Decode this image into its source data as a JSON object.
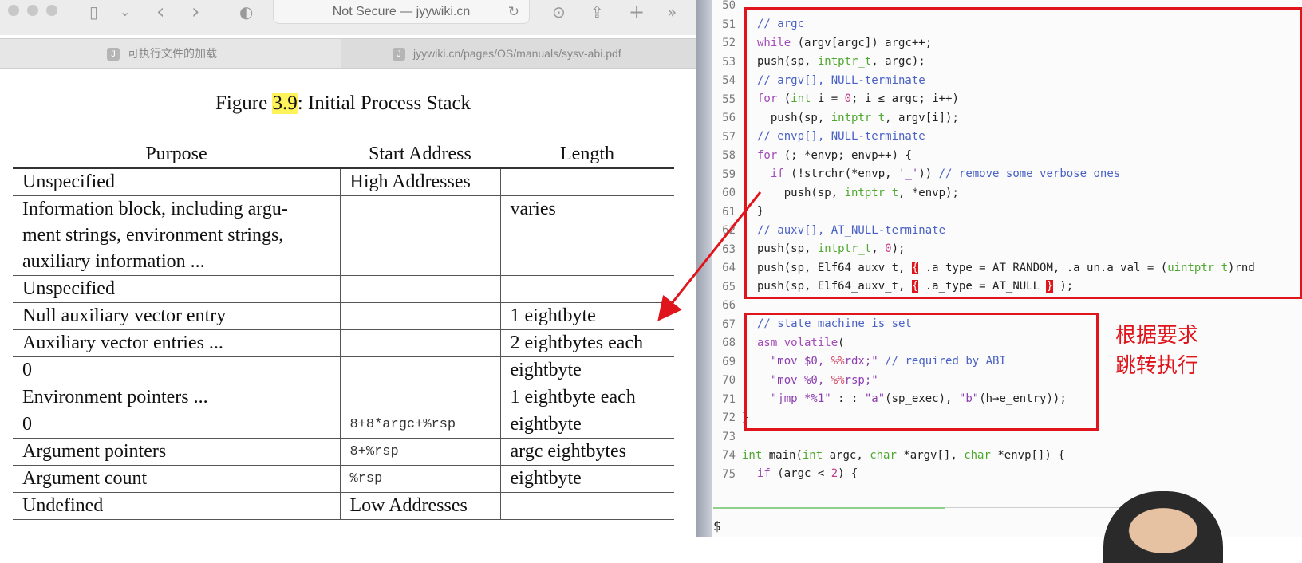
{
  "browser": {
    "url_text": "Not Secure — jyywiki.cn",
    "tabs": [
      {
        "favicon": "J",
        "label": "可执行文件的加载"
      },
      {
        "favicon": "J",
        "label": "jyywiki.cn/pages/OS/manuals/sysv-abi.pdf"
      }
    ],
    "icons": {
      "sidebar": "▯",
      "chevron": "⌄",
      "back": "‹",
      "forward": "›",
      "shield": "◐",
      "reload": "↻",
      "download": "⊙",
      "share": "⇪",
      "new_tab": "+",
      "more": "»"
    }
  },
  "pdf": {
    "caption_prefix": "Figure ",
    "caption_number": "3.9",
    "caption_suffix": ": Initial Process Stack",
    "headers": [
      "Purpose",
      "Start Address",
      "Length"
    ],
    "rows": [
      {
        "purpose": "Unspecified",
        "address": "High Addresses",
        "length": ""
      },
      {
        "purpose": "Information block, including argu-",
        "address": "",
        "length": "varies"
      },
      {
        "purpose": "ment strings, environment strings,",
        "address": "",
        "length": ""
      },
      {
        "purpose": "auxiliary information ...",
        "address": "",
        "length": ""
      },
      {
        "purpose": "Unspecified",
        "address": "",
        "length": ""
      },
      {
        "purpose": "Null auxiliary vector entry",
        "address": "",
        "length": "1 eightbyte"
      },
      {
        "purpose": "Auxiliary vector entries ...",
        "address": "",
        "length": "2 eightbytes each"
      },
      {
        "purpose": "0",
        "address": "",
        "length": "eightbyte"
      },
      {
        "purpose": "Environment pointers ...",
        "address": "",
        "length": "1 eightbyte each"
      },
      {
        "purpose": "0",
        "address": "8+8*argc+%rsp",
        "length": "eightbyte"
      },
      {
        "purpose": "Argument pointers",
        "address": "8+%rsp",
        "length": "argc eightbytes"
      },
      {
        "purpose": "Argument count",
        "address": "%rsp",
        "length": "eightbyte"
      },
      {
        "purpose": "Undefined",
        "address": "Low Addresses",
        "length": ""
      }
    ]
  },
  "editor": {
    "line_numbers": [
      "50",
      "51",
      "52",
      "53",
      "54",
      "55",
      "56",
      "57",
      "58",
      "59",
      "60",
      "61",
      "62",
      "63",
      "64",
      "65",
      "66",
      "67",
      "68",
      "69",
      "70",
      "71",
      "72",
      "73",
      "74",
      "75"
    ],
    "annotation_line1": "根据要求",
    "annotation_line2": "跳转执行",
    "prompt": "$",
    "accent_color": "#e0141b"
  }
}
